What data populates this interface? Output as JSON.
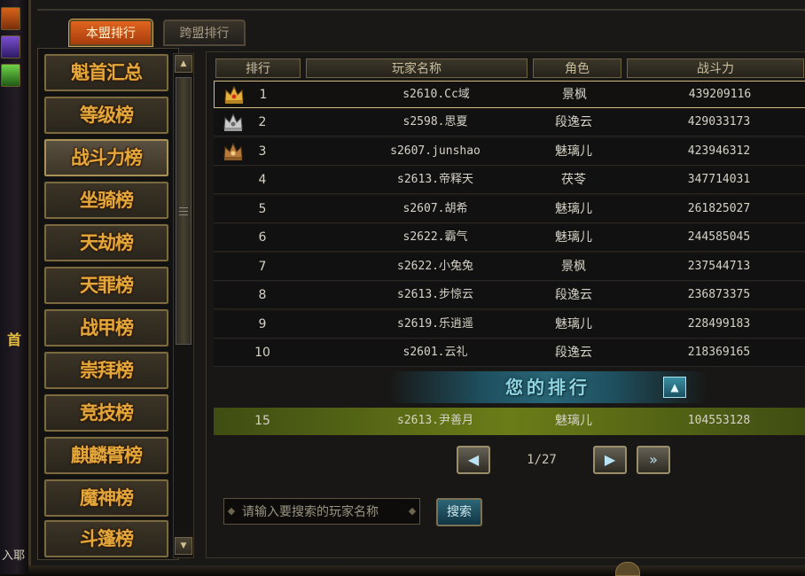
{
  "left_strip": {
    "partial_text_1": "首",
    "partial_text_2": "入耶"
  },
  "tabs": [
    {
      "label": "本盟排行",
      "active": true
    },
    {
      "label": "跨盟排行",
      "active": false
    }
  ],
  "sidebar": {
    "items": [
      {
        "label": "魁首汇总"
      },
      {
        "label": "等级榜"
      },
      {
        "label": "战斗力榜",
        "active": true
      },
      {
        "label": "坐骑榜"
      },
      {
        "label": "天劫榜"
      },
      {
        "label": "天罪榜"
      },
      {
        "label": "战甲榜"
      },
      {
        "label": "崇拜榜"
      },
      {
        "label": "竞技榜"
      },
      {
        "label": "麒麟臂榜"
      },
      {
        "label": "魔神榜"
      },
      {
        "label": "斗篷榜"
      }
    ]
  },
  "table": {
    "headers": {
      "rank": "排行",
      "name": "玩家名称",
      "role": "角色",
      "power": "战斗力"
    },
    "rows": [
      {
        "rank": "1",
        "name": "s2610.Cc域",
        "role": "景枫",
        "power": "439209116",
        "crown": "gold-crown-icon"
      },
      {
        "rank": "2",
        "name": "s2598.思夏",
        "role": "段逸云",
        "power": "429033173",
        "crown": "silver-crown-icon"
      },
      {
        "rank": "3",
        "name": "s2607.junshao",
        "role": "魅璃儿",
        "power": "423946312",
        "crown": "bronze-crown-icon"
      },
      {
        "rank": "4",
        "name": "s2613.帝释天",
        "role": "茯苓",
        "power": "347714031"
      },
      {
        "rank": "5",
        "name": "s2607.胡希",
        "role": "魅璃儿",
        "power": "261825027"
      },
      {
        "rank": "6",
        "name": "s2622.霸气",
        "role": "魅璃儿",
        "power": "244585045"
      },
      {
        "rank": "7",
        "name": "s2622.小兔兔",
        "role": "景枫",
        "power": "237544713"
      },
      {
        "rank": "8",
        "name": "s2613.步惊云",
        "role": "段逸云",
        "power": "236873375"
      },
      {
        "rank": "9",
        "name": "s2619.乐逍遥",
        "role": "魅璃儿",
        "power": "228499183"
      },
      {
        "rank": "10",
        "name": "s2601.云礼",
        "role": "段逸云",
        "power": "218369165"
      }
    ]
  },
  "my_rank": {
    "banner": "您的排行",
    "row": {
      "rank": "15",
      "name": "s2613.尹善月",
      "role": "魅璃儿",
      "power": "104553128"
    }
  },
  "pagination": {
    "text": "1/27"
  },
  "search": {
    "placeholder": "请输入要搜索的玩家名称",
    "button_label": "搜索"
  }
}
